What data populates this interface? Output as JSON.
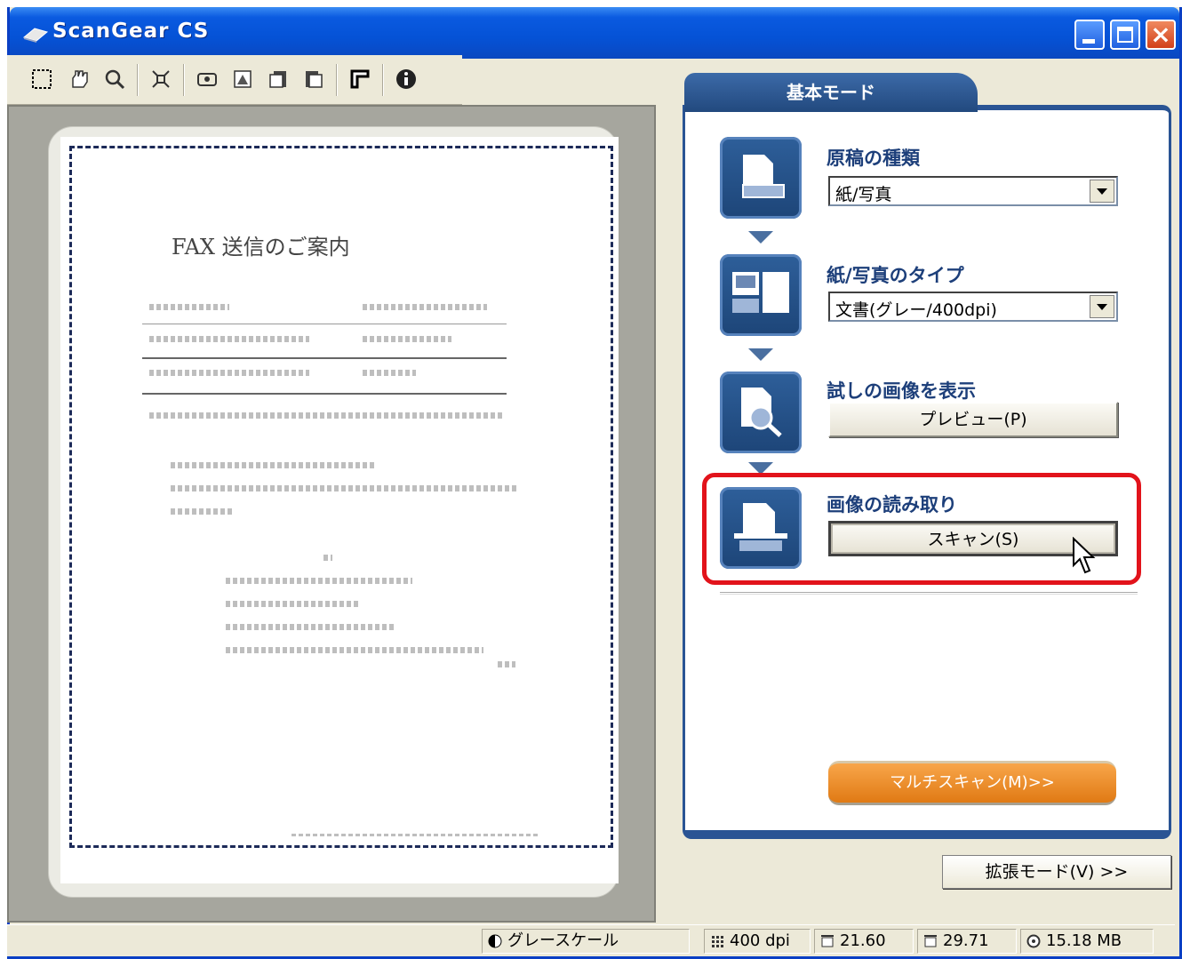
{
  "window": {
    "title": "ScanGear CS"
  },
  "toolbar": {
    "icons": [
      "select-icon",
      "hand-icon",
      "zoom-icon",
      "crop-fit-icon",
      "auto-crop-icon",
      "invert-icon",
      "rotate-left-icon",
      "rotate-right-icon",
      "frame-icon",
      "info-icon"
    ]
  },
  "preview": {
    "doc_title": "FAX 送信のご案内"
  },
  "mode": {
    "tab_label": "基本モード",
    "steps": [
      {
        "label": "原稿の種類",
        "control": "combo",
        "value": "紙/写真"
      },
      {
        "label": "紙/写真のタイプ",
        "control": "combo",
        "value": "文書(グレー/400dpi)"
      },
      {
        "label": "試しの画像を表示",
        "control": "button",
        "value": "プレビュー(P)"
      },
      {
        "label": "画像の読み取り",
        "control": "button",
        "value": "スキャン(S)"
      }
    ],
    "multi_scan_label": "マルチスキャン(M)>>",
    "advanced_label": "拡張モード(V) >>"
  },
  "status": {
    "color_mode": "グレースケール",
    "resolution": "400 dpi",
    "width": "21.60",
    "height": "29.71",
    "size": "15.18 MB"
  },
  "colors": {
    "accent": "#1d4578",
    "highlight": "#e2131b",
    "orange": "#e07a14"
  }
}
